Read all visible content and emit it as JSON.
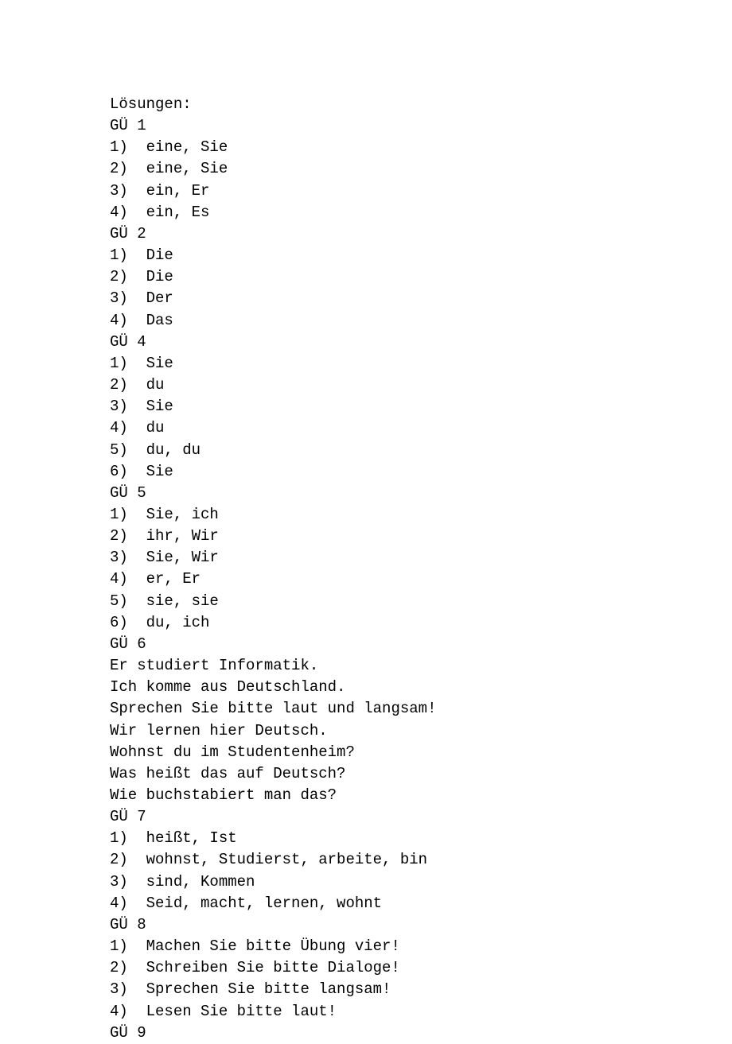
{
  "lines": [
    {
      "text": "Lösungen:",
      "type": "plain"
    },
    {
      "text": "GÜ 1",
      "type": "plain"
    },
    {
      "num": "1)",
      "text": "eine, Sie",
      "type": "numbered"
    },
    {
      "num": "2)",
      "text": "eine, Sie",
      "type": "numbered"
    },
    {
      "num": "3)",
      "text": "ein, Er",
      "type": "numbered"
    },
    {
      "num": "4)",
      "text": "ein, Es",
      "type": "numbered"
    },
    {
      "text": "GÜ 2",
      "type": "plain"
    },
    {
      "num": "1)",
      "text": "Die",
      "type": "numbered"
    },
    {
      "num": "2)",
      "text": "Die",
      "type": "numbered"
    },
    {
      "num": "3)",
      "text": "Der",
      "type": "numbered"
    },
    {
      "num": "4)",
      "text": "Das",
      "type": "numbered"
    },
    {
      "text": "GÜ 4",
      "type": "plain"
    },
    {
      "num": "1)",
      "text": "Sie",
      "type": "numbered"
    },
    {
      "num": "2)",
      "text": "du",
      "type": "numbered"
    },
    {
      "num": "3)",
      "text": "Sie",
      "type": "numbered"
    },
    {
      "num": "4)",
      "text": "du",
      "type": "numbered"
    },
    {
      "num": "5)",
      "text": "du, du",
      "type": "numbered-tight"
    },
    {
      "num": "6)",
      "text": "Sie",
      "type": "numbered"
    },
    {
      "text": "GÜ 5",
      "type": "plain"
    },
    {
      "num": "1)",
      "text": "Sie, ich",
      "type": "numbered"
    },
    {
      "num": "2)",
      "text": "ihr, Wir",
      "type": "numbered"
    },
    {
      "num": "3)",
      "text": "Sie, Wir",
      "type": "numbered"
    },
    {
      "num": "4)",
      "text": "er, Er",
      "type": "numbered"
    },
    {
      "num": "5)",
      "text": "sie, sie",
      "type": "numbered"
    },
    {
      "num": "6)",
      "text": "du, ich",
      "type": "numbered"
    },
    {
      "text": "GÜ 6",
      "type": "plain"
    },
    {
      "text": "Er studiert Informatik.",
      "type": "plain"
    },
    {
      "text": "Ich komme aus Deutschland.",
      "type": "plain"
    },
    {
      "text": "Sprechen Sie bitte laut und langsam!",
      "type": "plain"
    },
    {
      "text": "Wir lernen hier Deutsch.",
      "type": "plain"
    },
    {
      "text": "Wohnst du im Studentenheim?",
      "type": "plain"
    },
    {
      "text": "Was heißt das auf Deutsch?",
      "type": "plain"
    },
    {
      "text": "Wie buchstabiert man das?",
      "type": "plain"
    },
    {
      "text": "GÜ 7",
      "type": "plain"
    },
    {
      "num": "1)",
      "text": "heißt, Ist",
      "type": "numbered"
    },
    {
      "num": "2)",
      "text": "wohnst, Studierst, arbeite, bin",
      "type": "numbered"
    },
    {
      "num": "3)",
      "text": "sind, Kommen",
      "type": "numbered"
    },
    {
      "num": "4)",
      "text": "Seid, macht, lernen, wohnt",
      "type": "numbered"
    },
    {
      "text": "GÜ 8",
      "type": "plain"
    },
    {
      "num": "1)",
      "text": "Machen Sie bitte Übung vier!",
      "type": "numbered"
    },
    {
      "num": "2)",
      "text": "Schreiben Sie bitte Dialoge!",
      "type": "numbered"
    },
    {
      "num": "3)",
      "text": "Sprechen Sie bitte langsam!",
      "type": "numbered"
    },
    {
      "num": "4)",
      "text": "Lesen Sie bitte laut!",
      "type": "numbered"
    },
    {
      "text": "GÜ 9",
      "type": "plain"
    }
  ]
}
